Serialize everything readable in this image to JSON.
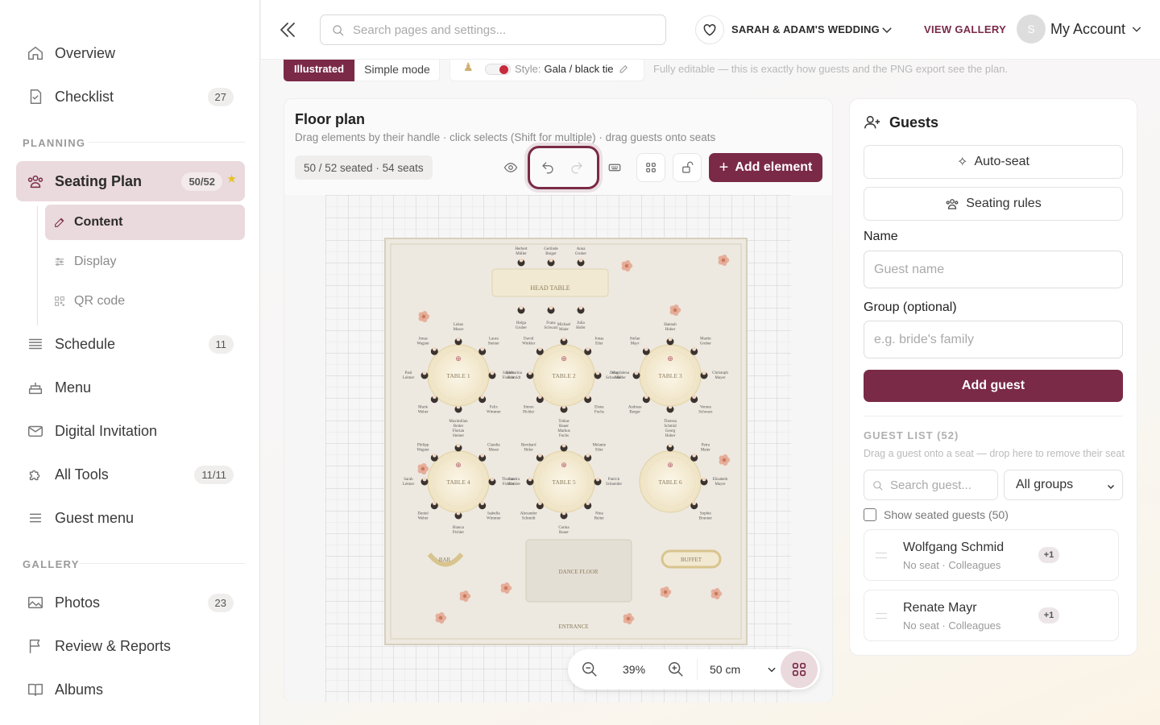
{
  "sidebar": {
    "items": [
      {
        "label": "Overview",
        "icon": "home-icon"
      },
      {
        "label": "Checklist",
        "icon": "checklist-icon",
        "badge": "27"
      },
      {
        "label": "Seating Plan",
        "icon": "seating-icon",
        "badge": "50/52"
      },
      {
        "label": "Schedule",
        "icon": "schedule-icon",
        "badge": "11"
      },
      {
        "label": "Menu",
        "icon": "cake-icon"
      },
      {
        "label": "Digital Invitation",
        "icon": "mail-icon"
      },
      {
        "label": "All Tools",
        "icon": "puzzle-icon",
        "badge": "11/11"
      },
      {
        "label": "Guest menu",
        "icon": "menu-lines-icon"
      },
      {
        "label": "Photos",
        "icon": "image-icon",
        "badge": "23"
      },
      {
        "label": "Review & Reports",
        "icon": "flag-icon"
      },
      {
        "label": "Albums",
        "icon": "book-icon"
      }
    ],
    "sections": {
      "planning": "PLANNING",
      "gallery": "GALLERY"
    },
    "sub_items": [
      {
        "label": "Content",
        "icon": "edit-icon"
      },
      {
        "label": "Display",
        "icon": "sliders-icon"
      },
      {
        "label": "QR code",
        "icon": "qr-icon"
      }
    ]
  },
  "topbar": {
    "search_placeholder": "Search pages and settings...",
    "wedding": "SARAH & ADAM'S WEDDING",
    "view_gallery": "VIEW GALLERY",
    "account": "My Account",
    "avatar_initial": "S"
  },
  "modebar": {
    "illustrated": "Illustrated",
    "simple": "Simple mode",
    "style_label": "Style:",
    "style_value": "Gala / black tie",
    "note": "Fully editable — this is exactly how guests and the PNG export see the plan."
  },
  "floorplan": {
    "title": "Floor plan",
    "subtitle": "Drag elements by their handle · click selects (Shift for multiple) · drag guests onto seats",
    "seated": "50 / 52 seated · 54 seats",
    "add_element": "Add element",
    "zoom": "39%",
    "grid_unit": "50 cm",
    "head_table": "HEAD TABLE",
    "head_guests": [
      "Herbert Müller",
      "Gerlinde Berger",
      "Anna Gruber",
      "Helga Gruber",
      "Franz Schwarz",
      "Julia Hofer"
    ],
    "tables": [
      {
        "label": "TABLE 1",
        "guests": [
          "Lukas Moser",
          "Laura Steiner",
          "Sophie Fischer",
          "Felix Wimmer",
          "Maximilian Reiter",
          "Marie Weber",
          "Paul Leitner",
          "Jonas Wagner"
        ]
      },
      {
        "label": "TABLE 2",
        "guests": [
          "Michael Maier",
          "Jonas Eder",
          "Lena Schneider",
          "Elena Fuchs",
          "Tobias Bauer",
          "Simon Pichler",
          "Katharina Schmidt",
          "David Winkler"
        ]
      },
      {
        "label": "TABLE 3",
        "guests": [
          "Hannah Huber",
          "Martin Gruber",
          "Christoph Mayer",
          "Verena Schwarz",
          "Theresa Schmid",
          "Andreas Berger",
          "Magdalena Müller",
          "Stefan Mayr"
        ]
      },
      {
        "label": "TABLE 4",
        "guests": [
          "Florian Steiner",
          "Claudia Moser",
          "Thomas Fischer",
          "Isabella Wimmer",
          "Bianca Pichler",
          "Daniel Weber",
          "Sarah Leitner",
          "Philipp Wagner"
        ]
      },
      {
        "label": "TABLE 5",
        "guests": [
          "Markus Fuchs",
          "Melanie Eder",
          "Patrick Schneider",
          "Nina Reiter",
          "Carina Bauer",
          "Alexander Schmidt",
          "Sandra Winkler",
          "Bernhard Hofer"
        ]
      },
      {
        "label": "TABLE 6",
        "guests": [
          "Georg Huber",
          "Petra Maier",
          "Elisabeth Mayer",
          "Sophie Brunner"
        ]
      }
    ],
    "bar": "BAR",
    "buffet": "BUFFET",
    "dance_floor": "DANCE FLOOR",
    "entrance": "ENTRANCE"
  },
  "guests": {
    "title": "Guests",
    "auto_seat": "Auto-seat",
    "seating_rules": "Seating rules",
    "name_label": "Name",
    "name_placeholder": "Guest name",
    "group_label": "Group (optional)",
    "group_placeholder": "e.g. bride's family",
    "add_guest": "Add guest",
    "list_title": "GUEST LIST (52)",
    "list_hint": "Drag a guest onto a seat — drop here to remove their seat",
    "search_placeholder": "Search guest...",
    "group_filter": "All groups",
    "show_seated": "Show seated guests (50)",
    "list": [
      {
        "name": "Wolfgang Schmid",
        "meta": "No seat · Colleagues",
        "plus": "+1"
      },
      {
        "name": "Renate Mayr",
        "meta": "No seat · Colleagues",
        "plus": "+1"
      }
    ]
  },
  "colors": {
    "accent": "#7a2a47",
    "accent_light": "#ead9dd",
    "star": "#e3c21f"
  }
}
